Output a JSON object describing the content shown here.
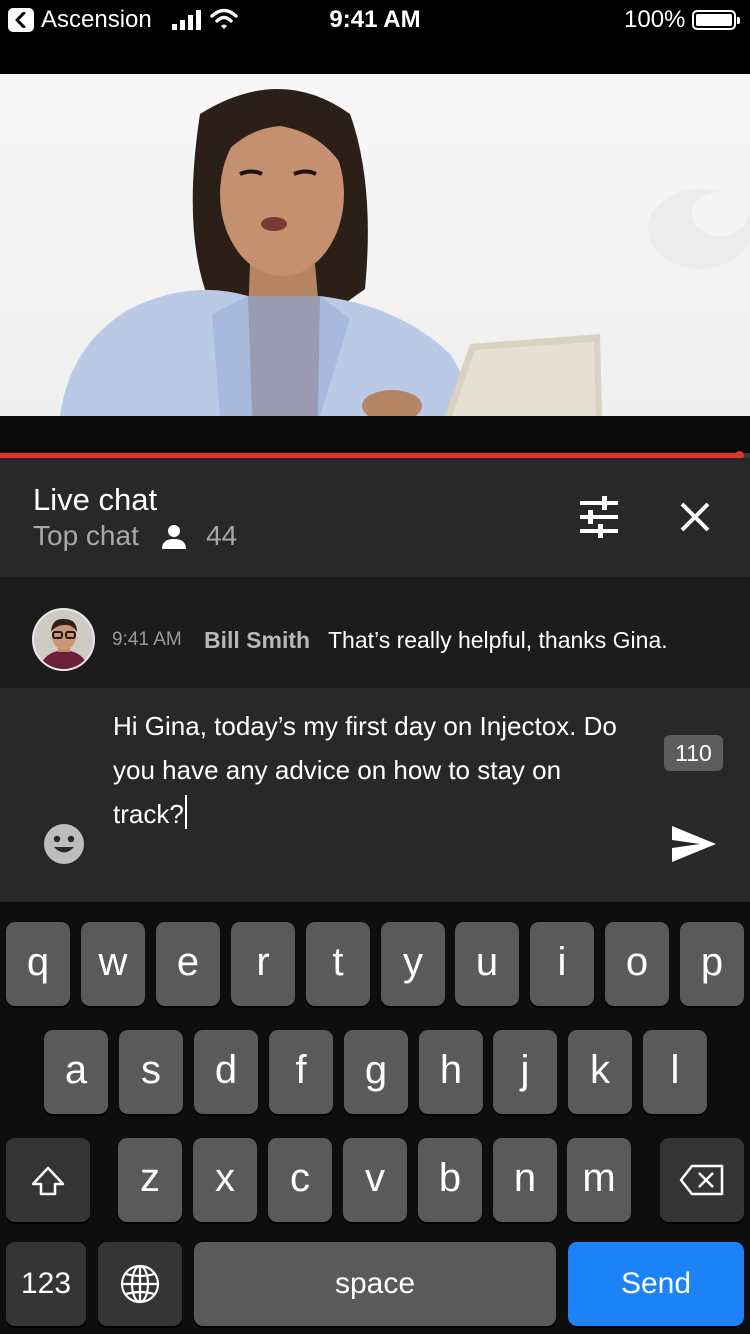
{
  "status_bar": {
    "back_label": "Ascension",
    "time": "9:41 AM",
    "battery": "100%"
  },
  "video": {
    "progress": 0.985,
    "progress_color": "#e0332b"
  },
  "chat_header": {
    "title": "Live chat",
    "mode": "Top chat",
    "viewer_count": "44"
  },
  "messages": [
    {
      "time": "9:41 AM",
      "author": "Bill Smith",
      "text": "That’s really helpful, thanks Gina."
    }
  ],
  "compose": {
    "text": "Hi Gina, today’s my first day on Injectox. Do you have any advice on how to stay on track?",
    "char_count": "110"
  },
  "keyboard": {
    "row1": [
      "q",
      "w",
      "e",
      "r",
      "t",
      "y",
      "u",
      "i",
      "o",
      "p"
    ],
    "row2": [
      "a",
      "s",
      "d",
      "f",
      "g",
      "h",
      "j",
      "k",
      "l"
    ],
    "row3": [
      "z",
      "x",
      "c",
      "v",
      "b",
      "n",
      "m"
    ],
    "numbers_label": "123",
    "space_label": "space",
    "send_label": "Send",
    "send_color": "#1c82f7"
  },
  "icons": {
    "back": "back-chevron-icon",
    "signal": "cellular-signal-icon",
    "wifi": "wifi-icon",
    "battery": "battery-icon",
    "viewers": "person-icon",
    "filter": "sliders-icon",
    "close": "close-icon",
    "emoji": "emoji-icon",
    "send": "send-icon",
    "shift": "shift-icon",
    "backspace": "backspace-icon",
    "globe": "globe-icon"
  }
}
